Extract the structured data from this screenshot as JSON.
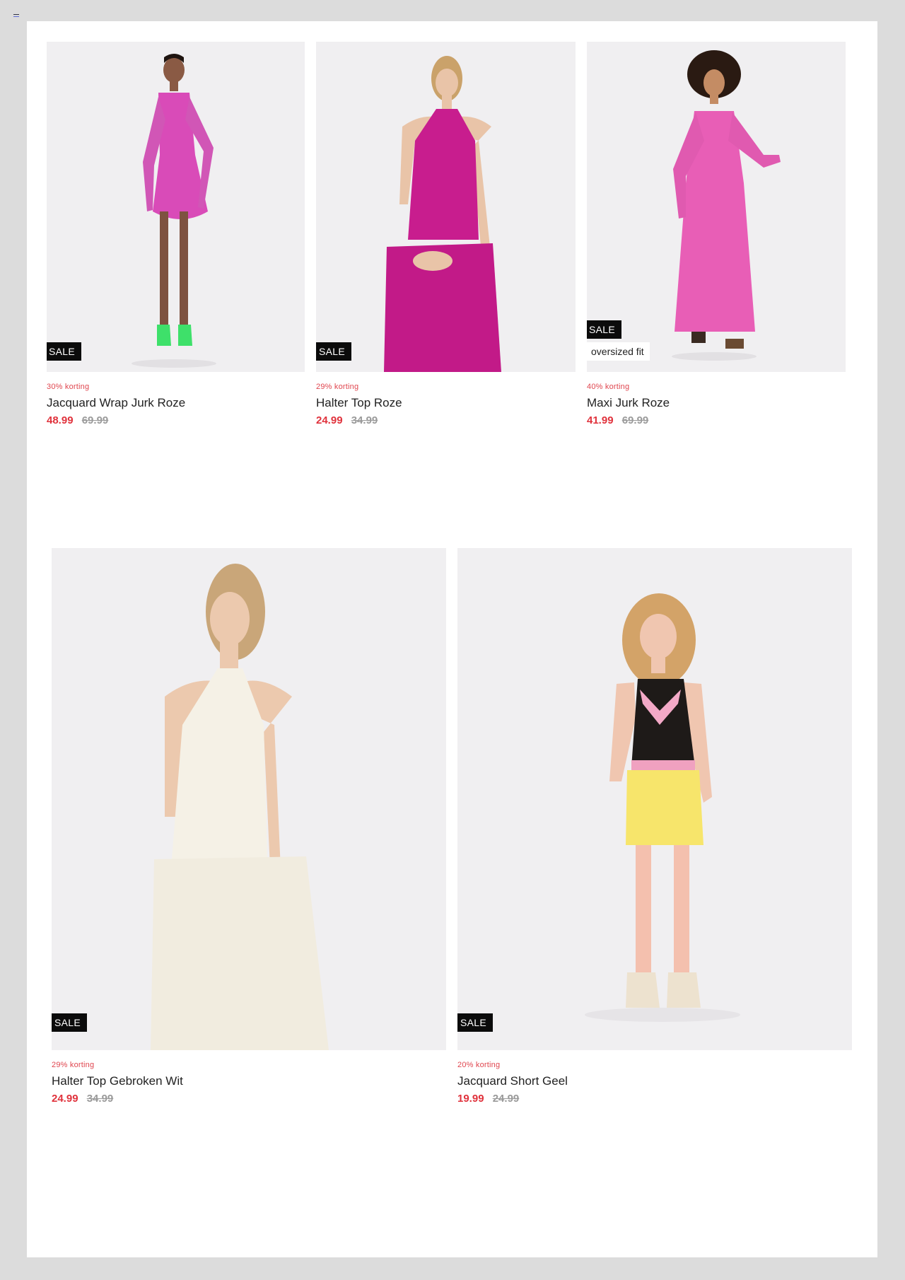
{
  "header": {
    "menu_icon": "hamburger-icon"
  },
  "colors": {
    "sale_price": "#e0323c",
    "discount": "#e0464f",
    "badge_bg": "#0b0b0b",
    "photo_bg": "#f0eff1"
  },
  "products": [
    {
      "badge": "SALE",
      "tag": "",
      "discount": "30% korting",
      "title": "Jacquard Wrap Jurk Roze",
      "price_now": "48.99",
      "price_old": "69.99",
      "garment": "pink wrap dress"
    },
    {
      "badge": "SALE",
      "tag": "",
      "discount": "29% korting",
      "title": "Halter Top Roze",
      "price_now": "24.99",
      "price_old": "34.99",
      "garment": "magenta halter top"
    },
    {
      "badge": "SALE",
      "tag": "oversized fit",
      "discount": "40% korting",
      "title": "Maxi Jurk Roze",
      "price_now": "41.99",
      "price_old": "69.99",
      "garment": "pink maxi dress"
    },
    {
      "badge": "SALE",
      "tag": "",
      "discount": "29% korting",
      "title": "Halter Top Gebroken Wit",
      "price_now": "24.99",
      "price_old": "34.99",
      "garment": "off-white halter top"
    },
    {
      "badge": "SALE",
      "tag": "",
      "discount": "20% korting",
      "title": "Jacquard Short Geel",
      "price_now": "19.99",
      "price_old": "24.99",
      "garment": "yellow jacquard short"
    }
  ]
}
